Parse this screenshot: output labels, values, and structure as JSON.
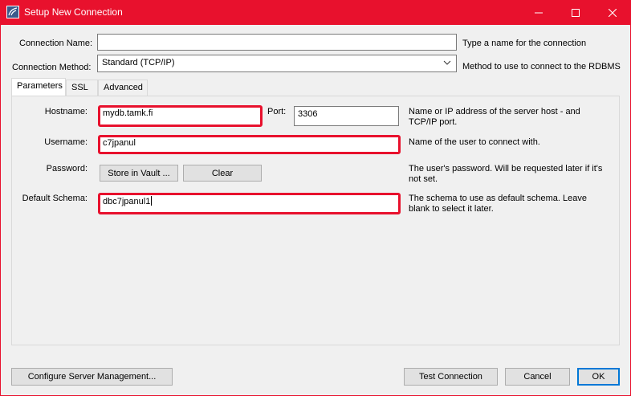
{
  "window": {
    "title": "Setup New Connection",
    "accent_color": "#e8112d",
    "icon": "mysql-workbench-icon"
  },
  "form": {
    "connection_name": {
      "label": "Connection Name:",
      "value": "",
      "hint": "Type a name for the connection"
    },
    "connection_method": {
      "label": "Connection Method:",
      "selected": "Standard (TCP/IP)",
      "hint": "Method to use to connect to the RDBMS"
    }
  },
  "tabs": [
    {
      "label": "Parameters",
      "active": true
    },
    {
      "label": "SSL",
      "active": false
    },
    {
      "label": "Advanced",
      "active": false
    }
  ],
  "parameters": {
    "hostname": {
      "label": "Hostname:",
      "value": "mydb.tamk.fi",
      "highlighted": true
    },
    "port": {
      "label": "Port:",
      "value": "3306",
      "hint": "Name or IP address of the server host - and TCP/IP port."
    },
    "username": {
      "label": "Username:",
      "value": "c7jpanul",
      "highlighted": true,
      "hint": "Name of the user to connect with."
    },
    "password": {
      "label": "Password:",
      "store_button": "Store in Vault ...",
      "clear_button": "Clear",
      "hint": "The user's password. Will be requested later if it's not set."
    },
    "default_schema": {
      "label": "Default Schema:",
      "value": "dbc7jpanul1",
      "highlighted": true,
      "hint": "The schema to use as default schema. Leave blank to select it later."
    }
  },
  "footer": {
    "configure_button": "Configure Server Management...",
    "test_button": "Test Connection",
    "cancel_button": "Cancel",
    "ok_button": "OK"
  }
}
